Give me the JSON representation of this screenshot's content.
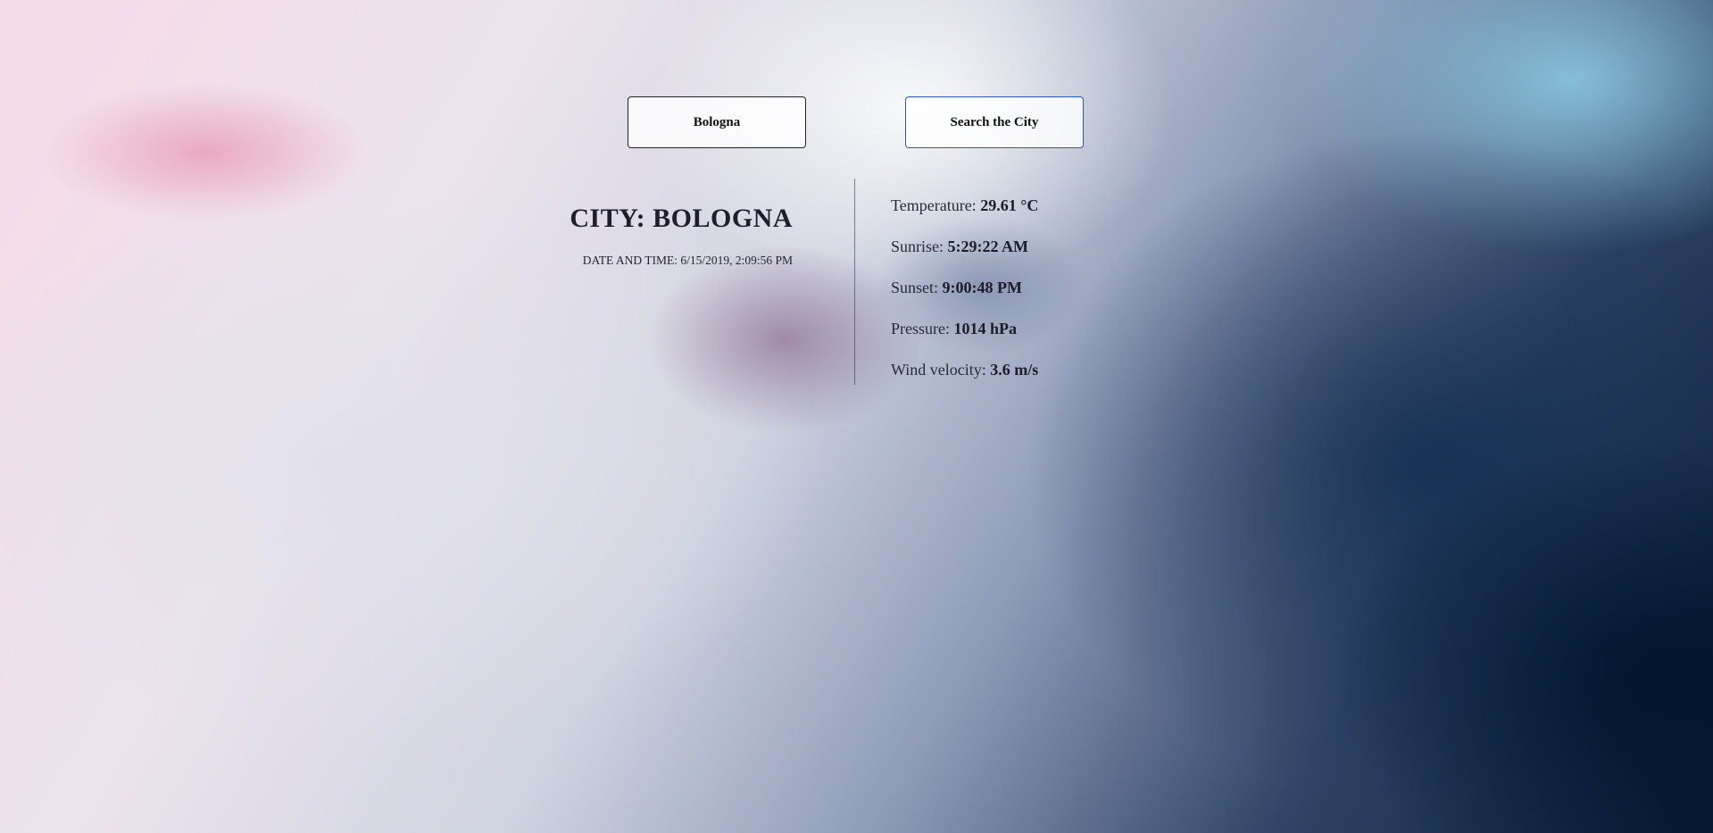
{
  "search": {
    "city_value": "Bologna",
    "button_label": "Search the City"
  },
  "city": {
    "title": "CITY: BOLOGNA",
    "datetime_label": "DATE AND TIME:",
    "datetime_value": "6/15/2019, 2:09:56 PM"
  },
  "weather": {
    "temperature": {
      "label": "Temperature:",
      "value": "29.61 °C"
    },
    "sunrise": {
      "label": "Sunrise:",
      "value": "5:29:22 AM"
    },
    "sunset": {
      "label": "Sunset:",
      "value": "9:00:48 PM"
    },
    "pressure": {
      "label": "Pressure:",
      "value": "1014 hPa"
    },
    "wind": {
      "label": "Wind velocity:",
      "value": "3.6 m/s"
    }
  }
}
